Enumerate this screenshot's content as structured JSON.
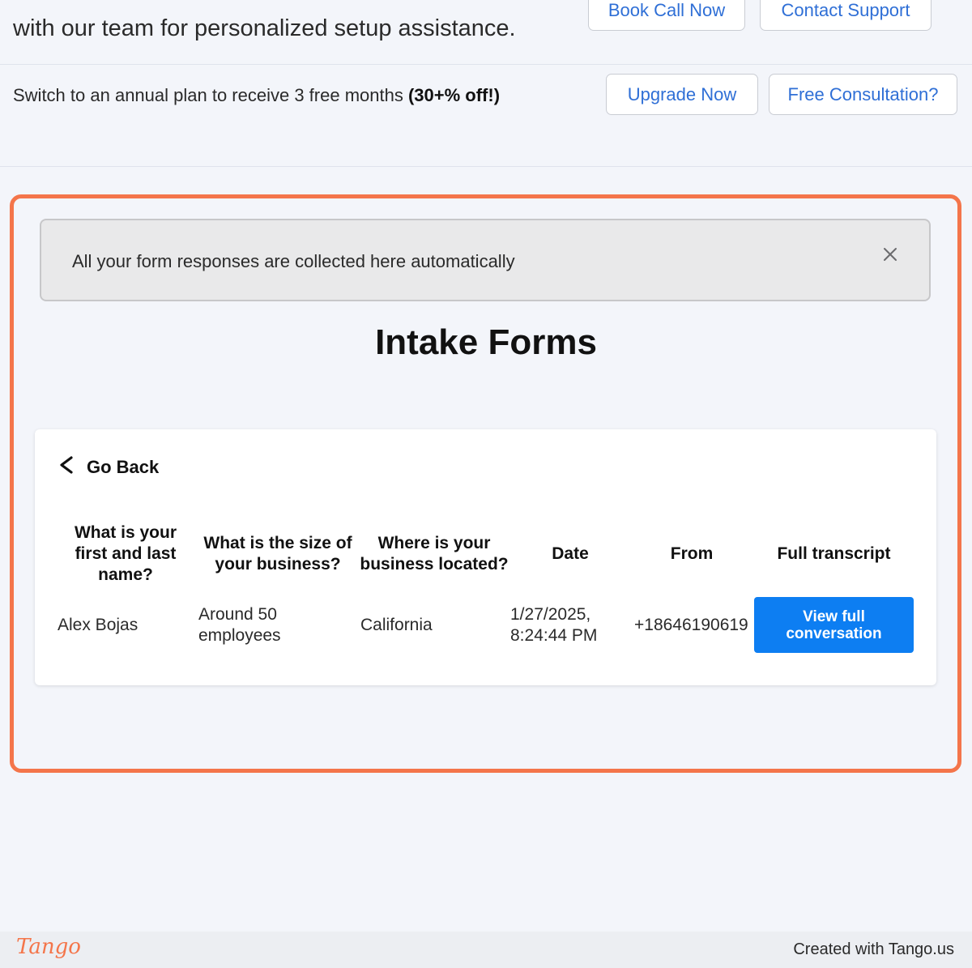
{
  "top_banner": {
    "setup_text": "with our team for personalized setup assistance.",
    "book_call_label": "Book Call Now",
    "contact_support_label": "Contact Support"
  },
  "promo": {
    "text": "Switch to an annual plan to receive 3 free months ",
    "highlight": "(30+% off!)",
    "upgrade_label": "Upgrade Now",
    "consult_label": "Free Consultation?"
  },
  "info_banner": {
    "text": "All your form responses are collected here automatically",
    "close_icon": "close-icon"
  },
  "page": {
    "title": "Intake Forms"
  },
  "card": {
    "back_label": "Go Back",
    "back_icon": "chevron-left-icon",
    "columns": [
      "What is your first and last name?",
      "What is the size of your business?",
      "Where is your business located?",
      "Date",
      "From",
      "Full transcript"
    ],
    "rows": [
      {
        "name": "Alex Bojas",
        "size": "Around 50 employees",
        "location": "California",
        "date": "1/27/2025, 8:24:44 PM",
        "from": "+18646190619",
        "action": "View full conversation"
      }
    ]
  },
  "footer": {
    "logo": "Tango",
    "created": "Created with Tango.us"
  },
  "colors": {
    "accent": "#f4754a",
    "primary_button": "#0d7ef2",
    "link_blue": "#2f6fd6"
  }
}
